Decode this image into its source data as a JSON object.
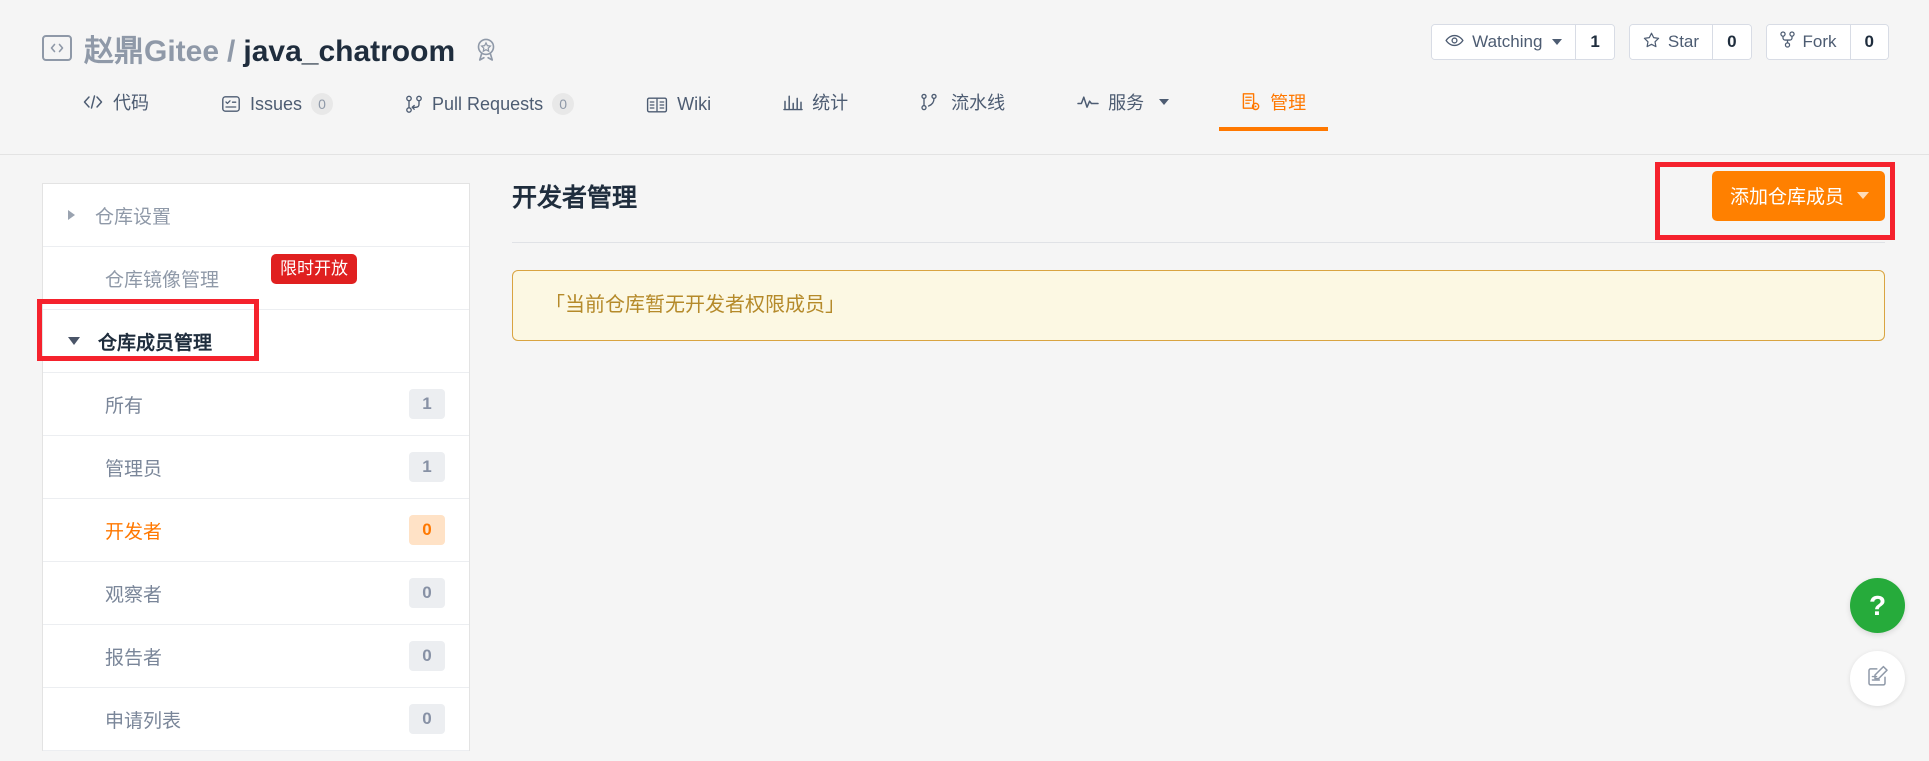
{
  "header": {
    "code_icon": "code-brackets-icon",
    "owner": "赵鼎Gitee",
    "separator": "/",
    "repo": "java_chatroom",
    "medal_icon": "medal-icon",
    "actions": [
      {
        "icon": "eye-icon",
        "label": "Watching",
        "has_caret": true,
        "count": "1",
        "name": "watch"
      },
      {
        "icon": "star-icon",
        "label": "Star",
        "has_caret": false,
        "count": "0",
        "name": "star"
      },
      {
        "icon": "fork-icon",
        "label": "Fork",
        "has_caret": false,
        "count": "0",
        "name": "fork"
      }
    ]
  },
  "nav": {
    "tabs": [
      {
        "icon": "code-icon",
        "label": "代码",
        "count": null,
        "active": false,
        "caret": false,
        "name": "code"
      },
      {
        "icon": "issues-icon",
        "label": "Issues",
        "count": "0",
        "active": false,
        "caret": false,
        "name": "issues"
      },
      {
        "icon": "pull-request-icon",
        "label": "Pull Requests",
        "count": "0",
        "active": false,
        "caret": false,
        "name": "pull-requests"
      },
      {
        "icon": "wiki-book-icon",
        "label": "Wiki",
        "count": null,
        "active": false,
        "caret": false,
        "name": "wiki"
      },
      {
        "icon": "chart-bar-icon",
        "label": "统计",
        "count": null,
        "active": false,
        "caret": false,
        "name": "statistics"
      },
      {
        "icon": "pipeline-icon",
        "label": "流水线",
        "count": null,
        "active": false,
        "caret": false,
        "name": "pipeline"
      },
      {
        "icon": "pulse-icon",
        "label": "服务",
        "count": null,
        "active": false,
        "caret": true,
        "name": "services"
      },
      {
        "icon": "manage-icon",
        "label": "管理",
        "count": null,
        "active": true,
        "caret": false,
        "name": "manage"
      }
    ]
  },
  "sidebar": {
    "items": [
      {
        "type": "group",
        "label": "仓库设置",
        "open": false,
        "arrow": "arrow-right-icon",
        "badge": null,
        "count": null,
        "active": false,
        "name": "repo-settings"
      },
      {
        "type": "plain",
        "label": "仓库镜像管理",
        "open": false,
        "arrow": null,
        "badge": "限时开放",
        "count": null,
        "active": false,
        "name": "repo-mirror-management"
      },
      {
        "type": "group",
        "label": "仓库成员管理",
        "open": true,
        "arrow": "arrow-down-icon",
        "badge": null,
        "count": null,
        "active": false,
        "name": "repo-member-management"
      },
      {
        "type": "sub",
        "label": "所有",
        "arrow": null,
        "badge": null,
        "count": "1",
        "active": false,
        "name": "members-all"
      },
      {
        "type": "sub",
        "label": "管理员",
        "arrow": null,
        "badge": null,
        "count": "1",
        "active": false,
        "name": "members-admin"
      },
      {
        "type": "sub",
        "label": "开发者",
        "arrow": null,
        "badge": null,
        "count": "0",
        "active": true,
        "name": "members-developer"
      },
      {
        "type": "sub",
        "label": "观察者",
        "arrow": null,
        "badge": null,
        "count": "0",
        "active": false,
        "name": "members-observer"
      },
      {
        "type": "sub",
        "label": "报告者",
        "arrow": null,
        "badge": null,
        "count": "0",
        "active": false,
        "name": "members-reporter"
      },
      {
        "type": "sub",
        "label": "申请列表",
        "arrow": null,
        "badge": null,
        "count": "0",
        "active": false,
        "name": "members-applications"
      }
    ]
  },
  "main": {
    "title": "开发者管理",
    "add_member_button": "添加仓库成员",
    "notice": "「当前仓库暂无开发者权限成员」"
  },
  "floating": {
    "help_label": "?",
    "help_icon": "question-mark-icon",
    "feedback_icon": "feedback-edit-icon"
  },
  "colors": {
    "accent_orange": "#ff7800",
    "button_orange": "#ff8000",
    "annotation_red": "#f5222d",
    "badge_red": "#e02020",
    "notice_bg": "#fcf8e3",
    "notice_border": "#d9a441",
    "notice_text": "#b58a2a",
    "help_green": "#26ab3b",
    "page_bg": "#f5f5f5",
    "text_dark": "#1f2d3d",
    "text_muted": "#8f99a8"
  }
}
